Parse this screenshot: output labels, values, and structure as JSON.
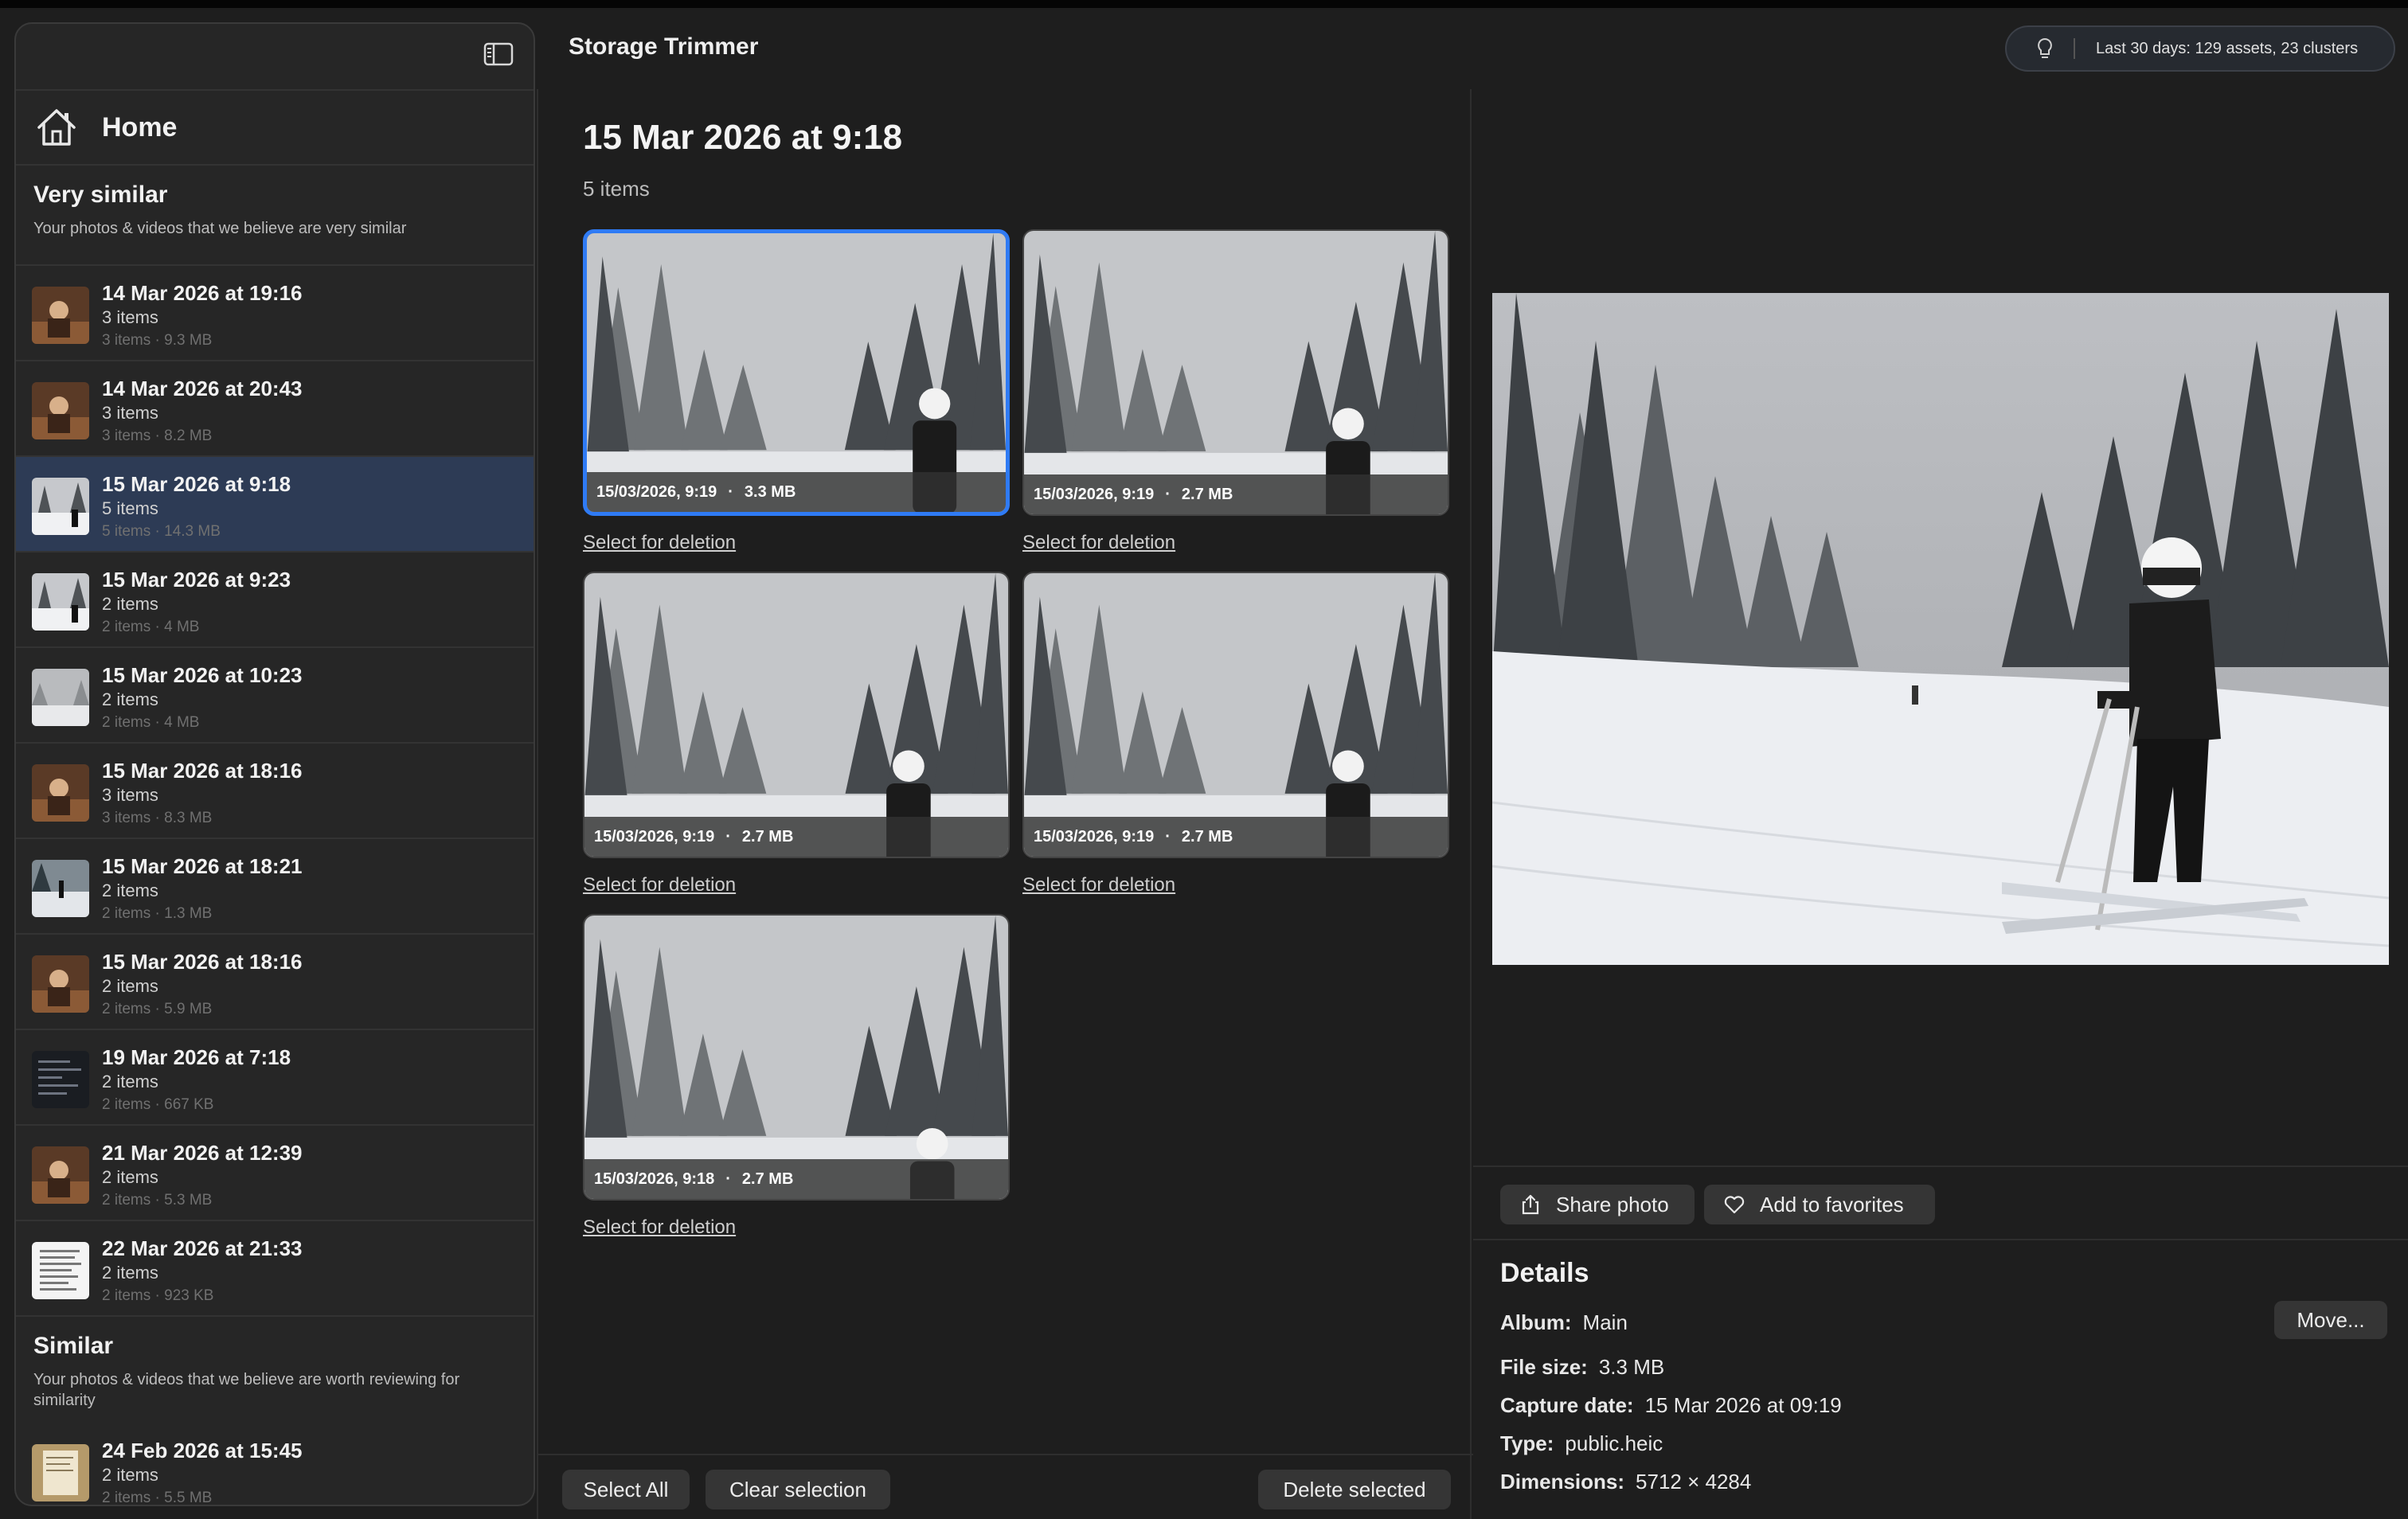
{
  "app": {
    "title": "Storage Trimmer"
  },
  "status": {
    "text": "Last 30 days: 129 assets, 23 clusters"
  },
  "sidebar": {
    "home_label": "Home",
    "very_similar": {
      "title": "Very similar",
      "subtitle": "Your photos & videos that we believe are very similar",
      "items": [
        {
          "title": "14 Mar 2026 at 19:16",
          "items": "3 items",
          "meta": "3 items · 9.3 MB",
          "thumb": "warm"
        },
        {
          "title": "14 Mar 2026 at 20:43",
          "items": "3 items",
          "meta": "3 items · 8.2 MB",
          "thumb": "warm"
        },
        {
          "title": "15 Mar 2026 at 9:18",
          "items": "5 items",
          "meta": "5 items · 14.3 MB",
          "thumb": "snow"
        },
        {
          "title": "15 Mar 2026 at 9:23",
          "items": "2 items",
          "meta": "2 items · 4 MB",
          "thumb": "snow"
        },
        {
          "title": "15 Mar 2026 at 10:23",
          "items": "2 items",
          "meta": "2 items · 4 MB",
          "thumb": "fog"
        },
        {
          "title": "15 Mar 2026 at 18:16",
          "items": "3 items",
          "meta": "3 items · 8.3 MB",
          "thumb": "warm"
        },
        {
          "title": "15 Mar 2026 at 18:21",
          "items": "2 items",
          "meta": "2 items · 1.3 MB",
          "thumb": "ski"
        },
        {
          "title": "15 Mar 2026 at 18:16",
          "items": "2 items",
          "meta": "2 items · 5.9 MB",
          "thumb": "warm"
        },
        {
          "title": "19 Mar 2026 at 7:18",
          "items": "2 items",
          "meta": "2 items · 667 KB",
          "thumb": "doc-dark"
        },
        {
          "title": "21 Mar 2026 at 12:39",
          "items": "2 items",
          "meta": "2 items · 5.3 MB",
          "thumb": "warm"
        },
        {
          "title": "22 Mar 2026 at 21:33",
          "items": "2 items",
          "meta": "2 items · 923 KB",
          "thumb": "doc"
        }
      ]
    },
    "similar": {
      "title": "Similar",
      "subtitle": "Your photos & videos that we believe are worth reviewing for similarity",
      "items": [
        {
          "title": "24 Feb 2026 at 15:45",
          "items": "2 items",
          "meta": "2 items · 5.5 MB",
          "thumb": "paper"
        }
      ]
    }
  },
  "cluster": {
    "title": "15 Mar 2026 at 9:18",
    "count": "5 items",
    "photos": [
      {
        "date": "15/03/2026, 9:19",
        "size": "3.3 MB",
        "action": "Select for deletion",
        "selected": true
      },
      {
        "date": "15/03/2026, 9:19",
        "size": "2.7 MB",
        "action": "Select for deletion",
        "selected": false
      },
      {
        "date": "15/03/2026, 9:19",
        "size": "2.7 MB",
        "action": "Select for deletion",
        "selected": false
      },
      {
        "date": "15/03/2026, 9:19",
        "size": "2.7 MB",
        "action": "Select for deletion",
        "selected": false
      },
      {
        "date": "15/03/2026, 9:18",
        "size": "2.7 MB",
        "action": "Select for deletion",
        "selected": false
      }
    ],
    "sep": "·"
  },
  "footer": {
    "select_all": "Select All",
    "clear_selection": "Clear selection",
    "delete_selected": "Delete selected"
  },
  "actions": {
    "share": "Share photo",
    "favorite": "Add to favorites"
  },
  "details": {
    "title": "Details",
    "album_label": "Album:",
    "album": "Main",
    "move_label": "Move...",
    "file_size_label": "File size:",
    "file_size": "3.3 MB",
    "capture_label": "Capture date:",
    "capture": "15 Mar 2026 at 09:19",
    "type_label": "Type:",
    "type": "public.heic",
    "dimensions_label": "Dimensions:",
    "dimensions": "5712 × 4284"
  },
  "icons": {
    "sidebar_toggle": "sidebar-toggle-icon",
    "home": "house-icon",
    "status": "lightbulb-icon",
    "share": "share-icon",
    "favorite": "heart-icon"
  },
  "colors": {
    "accent": "#2f7bf5",
    "selected_row": "#2d3b55"
  }
}
